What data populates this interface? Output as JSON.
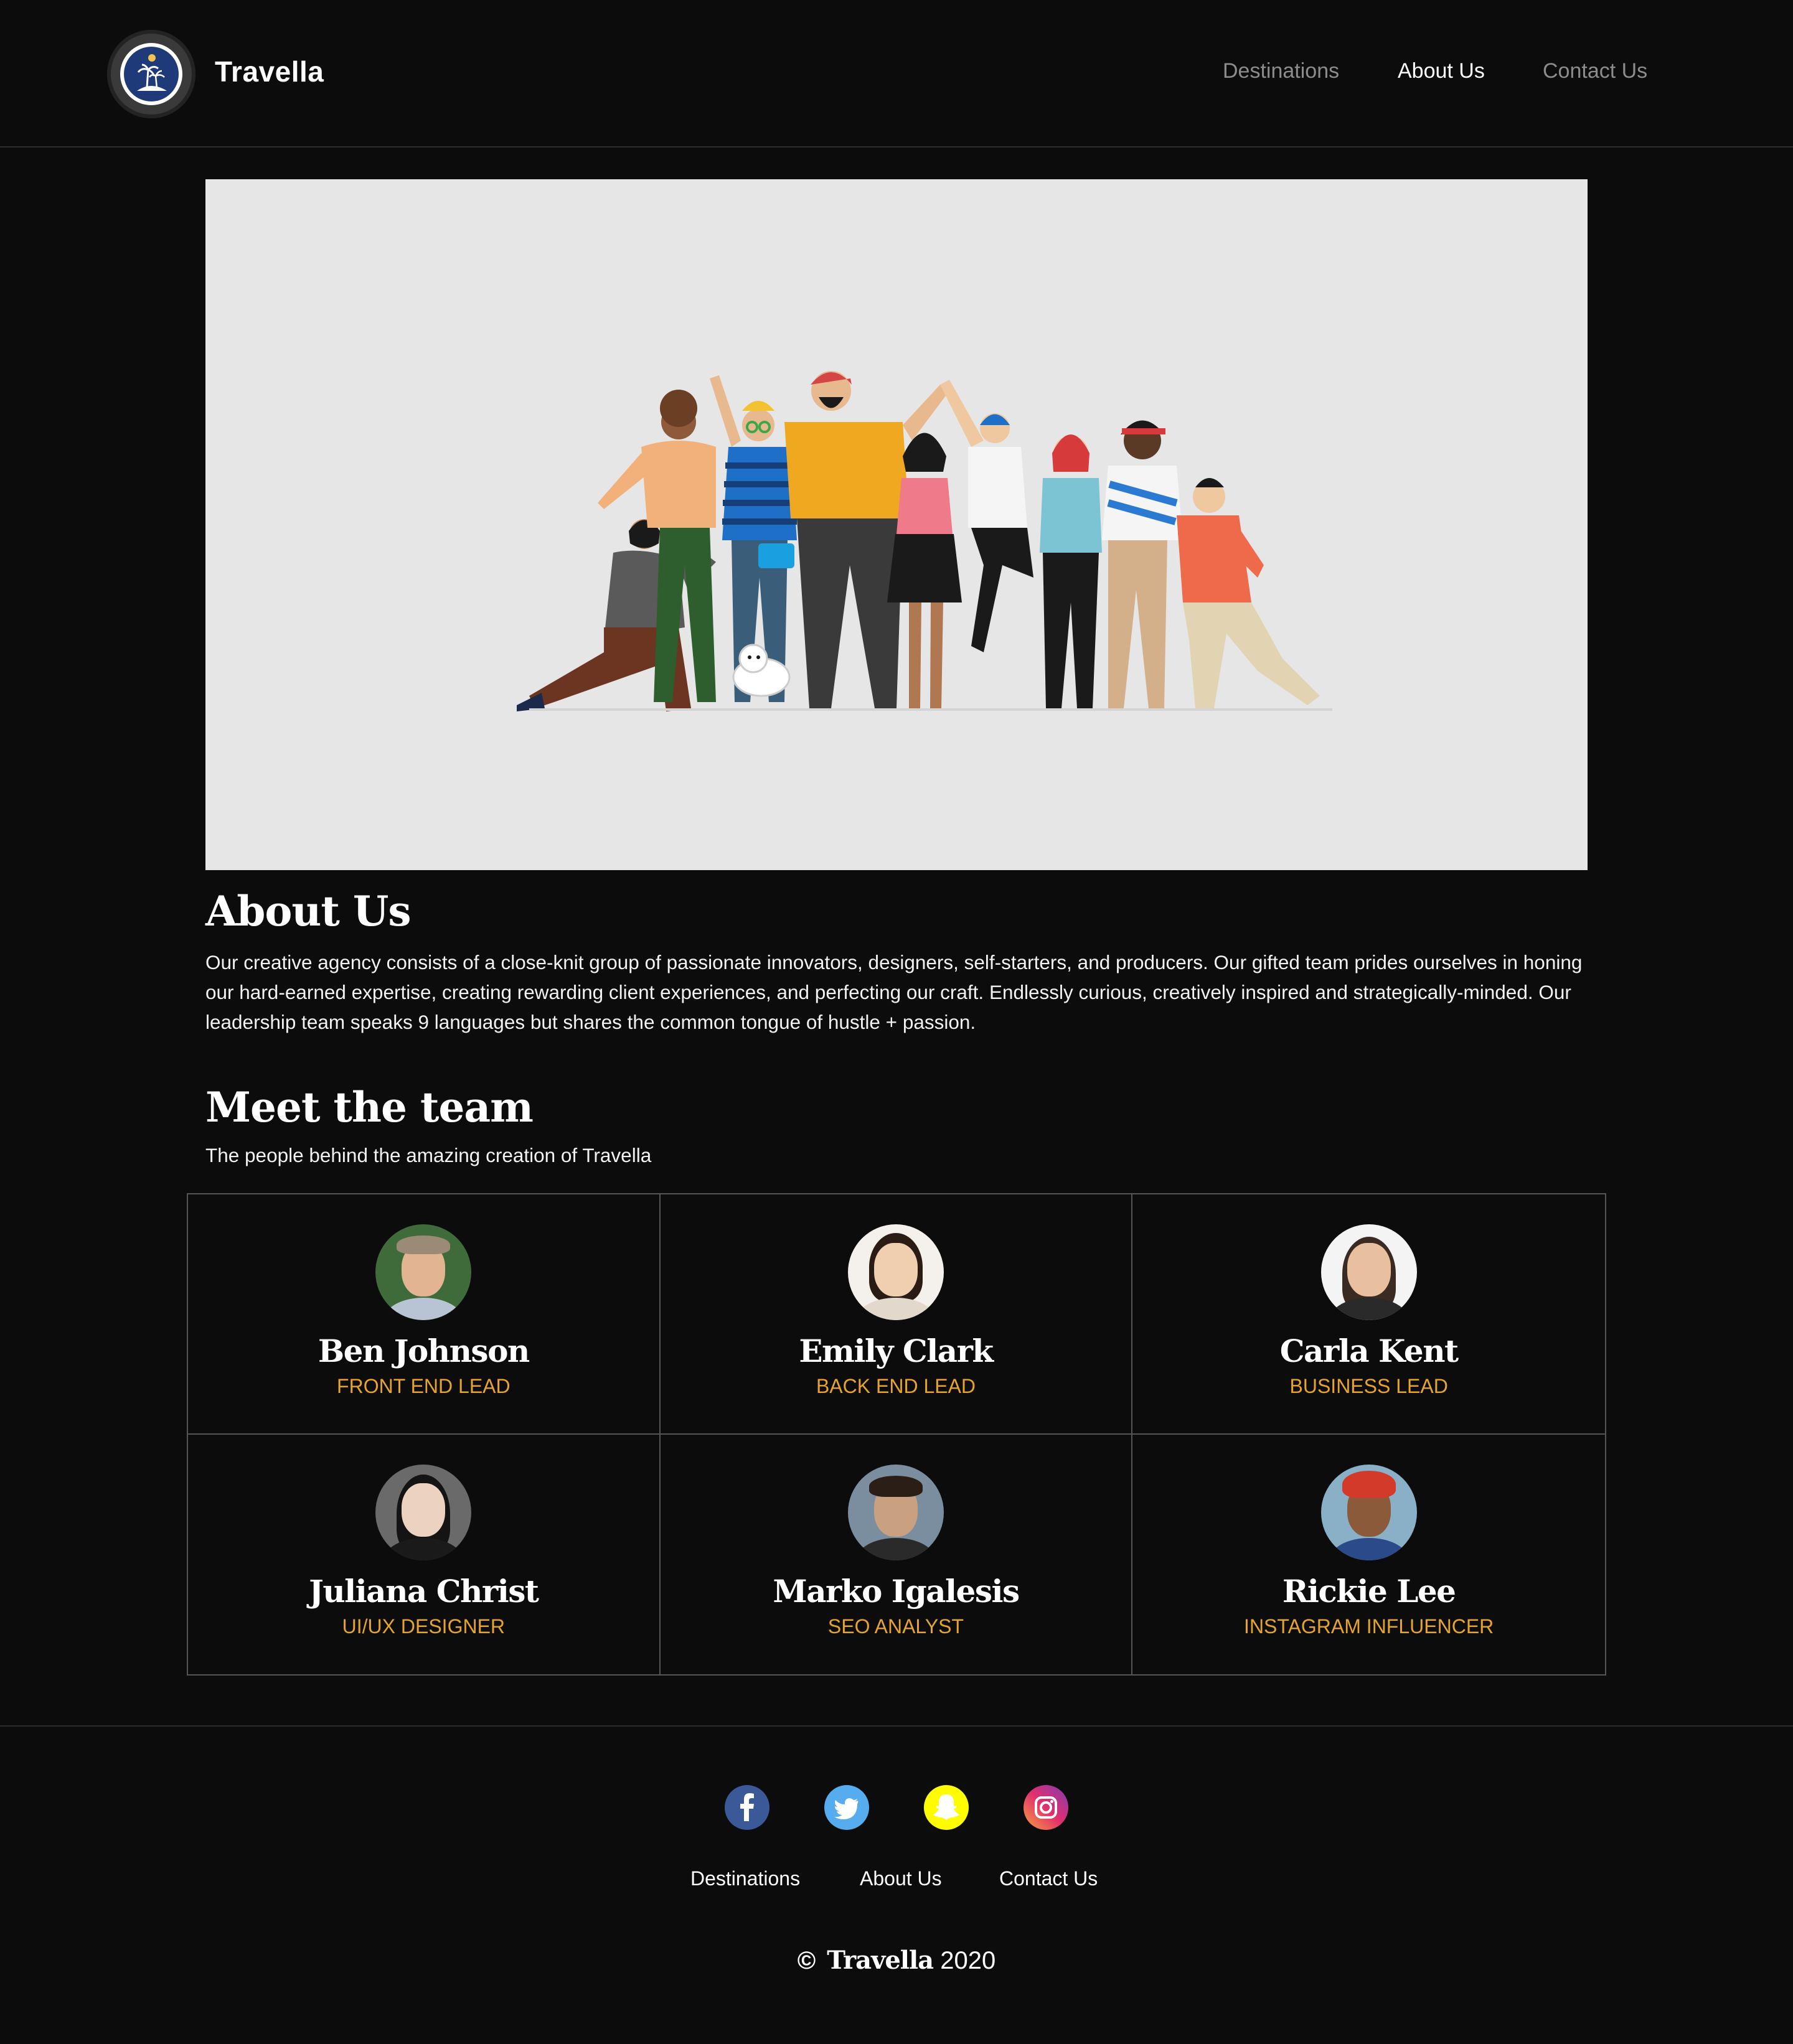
{
  "header": {
    "brand": "Travella",
    "logo_icon": "island-palm-icon",
    "nav": [
      {
        "label": "Destinations",
        "active": false
      },
      {
        "label": "About Us",
        "active": true
      },
      {
        "label": "Contact Us",
        "active": false
      }
    ]
  },
  "hero": {
    "image": "team-group-illustration"
  },
  "about": {
    "title": "About Us",
    "text": "Our creative agency consists of a close-knit group of passionate innovators, designers, self-starters, and producers. Our gifted team prides ourselves in honing our hard-earned expertise, creating rewarding client experiences, and perfecting our craft. Endlessly curious, creatively inspired and strategically-minded. Our leadership team speaks 9 languages but shares the common tongue of hustle + passion."
  },
  "team": {
    "title": "Meet the team",
    "subtitle": "The people behind the amazing creation of Travella",
    "members": [
      {
        "name": "Ben Johnson",
        "role": "FRONT END LEAD",
        "avatar": "ben-johnson-photo"
      },
      {
        "name": "Emily Clark",
        "role": "BACK END LEAD",
        "avatar": "emily-clark-photo"
      },
      {
        "name": "Carla Kent",
        "role": "BUSINESS LEAD",
        "avatar": "carla-kent-photo"
      },
      {
        "name": "Juliana Christ",
        "role": "UI/UX DESIGNER",
        "avatar": "juliana-christ-photo"
      },
      {
        "name": "Marko Igalesis",
        "role": "SEO ANALYST",
        "avatar": "marko-igalesis-photo"
      },
      {
        "name": "Rickie Lee",
        "role": "INSTAGRAM INFLUENCER",
        "avatar": "rickie-lee-photo"
      }
    ]
  },
  "footer": {
    "social": [
      {
        "icon": "facebook-icon",
        "color": "#3b5998"
      },
      {
        "icon": "twitter-icon",
        "color": "#55acee"
      },
      {
        "icon": "snapchat-icon",
        "color": "#fffc00"
      },
      {
        "icon": "instagram-icon",
        "color": "#d6249f"
      }
    ],
    "links": [
      "Destinations",
      "About Us",
      "Contact Us"
    ],
    "copyright_symbol": "©",
    "copyright_name": "Travella",
    "copyright_year": "2020"
  },
  "colors": {
    "background": "#0c0c0c",
    "accent": "#e6a42a",
    "hero_bg": "#e6e6e6",
    "nav_inactive": "#8c8c8c"
  }
}
